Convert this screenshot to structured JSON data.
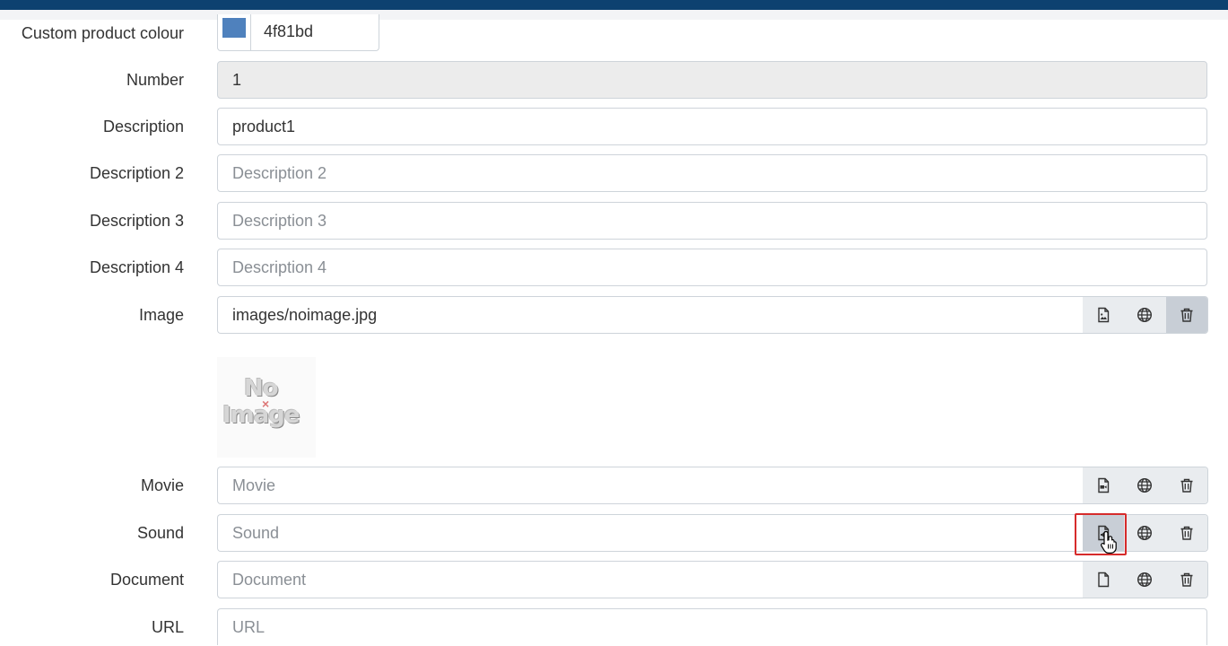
{
  "colours": {
    "topbar": "#0d4170",
    "product_swatch": "#4f81bd"
  },
  "form": {
    "custom_colour": {
      "label": "Custom product colour",
      "value": "4f81bd"
    },
    "number": {
      "label": "Number",
      "value": "1"
    },
    "description": {
      "label": "Description",
      "value": "product1"
    },
    "description2": {
      "label": "Description 2",
      "placeholder": "Description 2"
    },
    "description3": {
      "label": "Description 3",
      "placeholder": "Description 3"
    },
    "description4": {
      "label": "Description 4",
      "placeholder": "Description 4"
    },
    "image": {
      "label": "Image",
      "value": "images/noimage.jpg"
    },
    "image_preview": {
      "line1": "No",
      "line2": "Image"
    },
    "movie": {
      "label": "Movie",
      "placeholder": "Movie"
    },
    "sound": {
      "label": "Sound",
      "placeholder": "Sound"
    },
    "document": {
      "label": "Document",
      "placeholder": "Document"
    },
    "url": {
      "label": "URL",
      "placeholder": "URL"
    }
  }
}
